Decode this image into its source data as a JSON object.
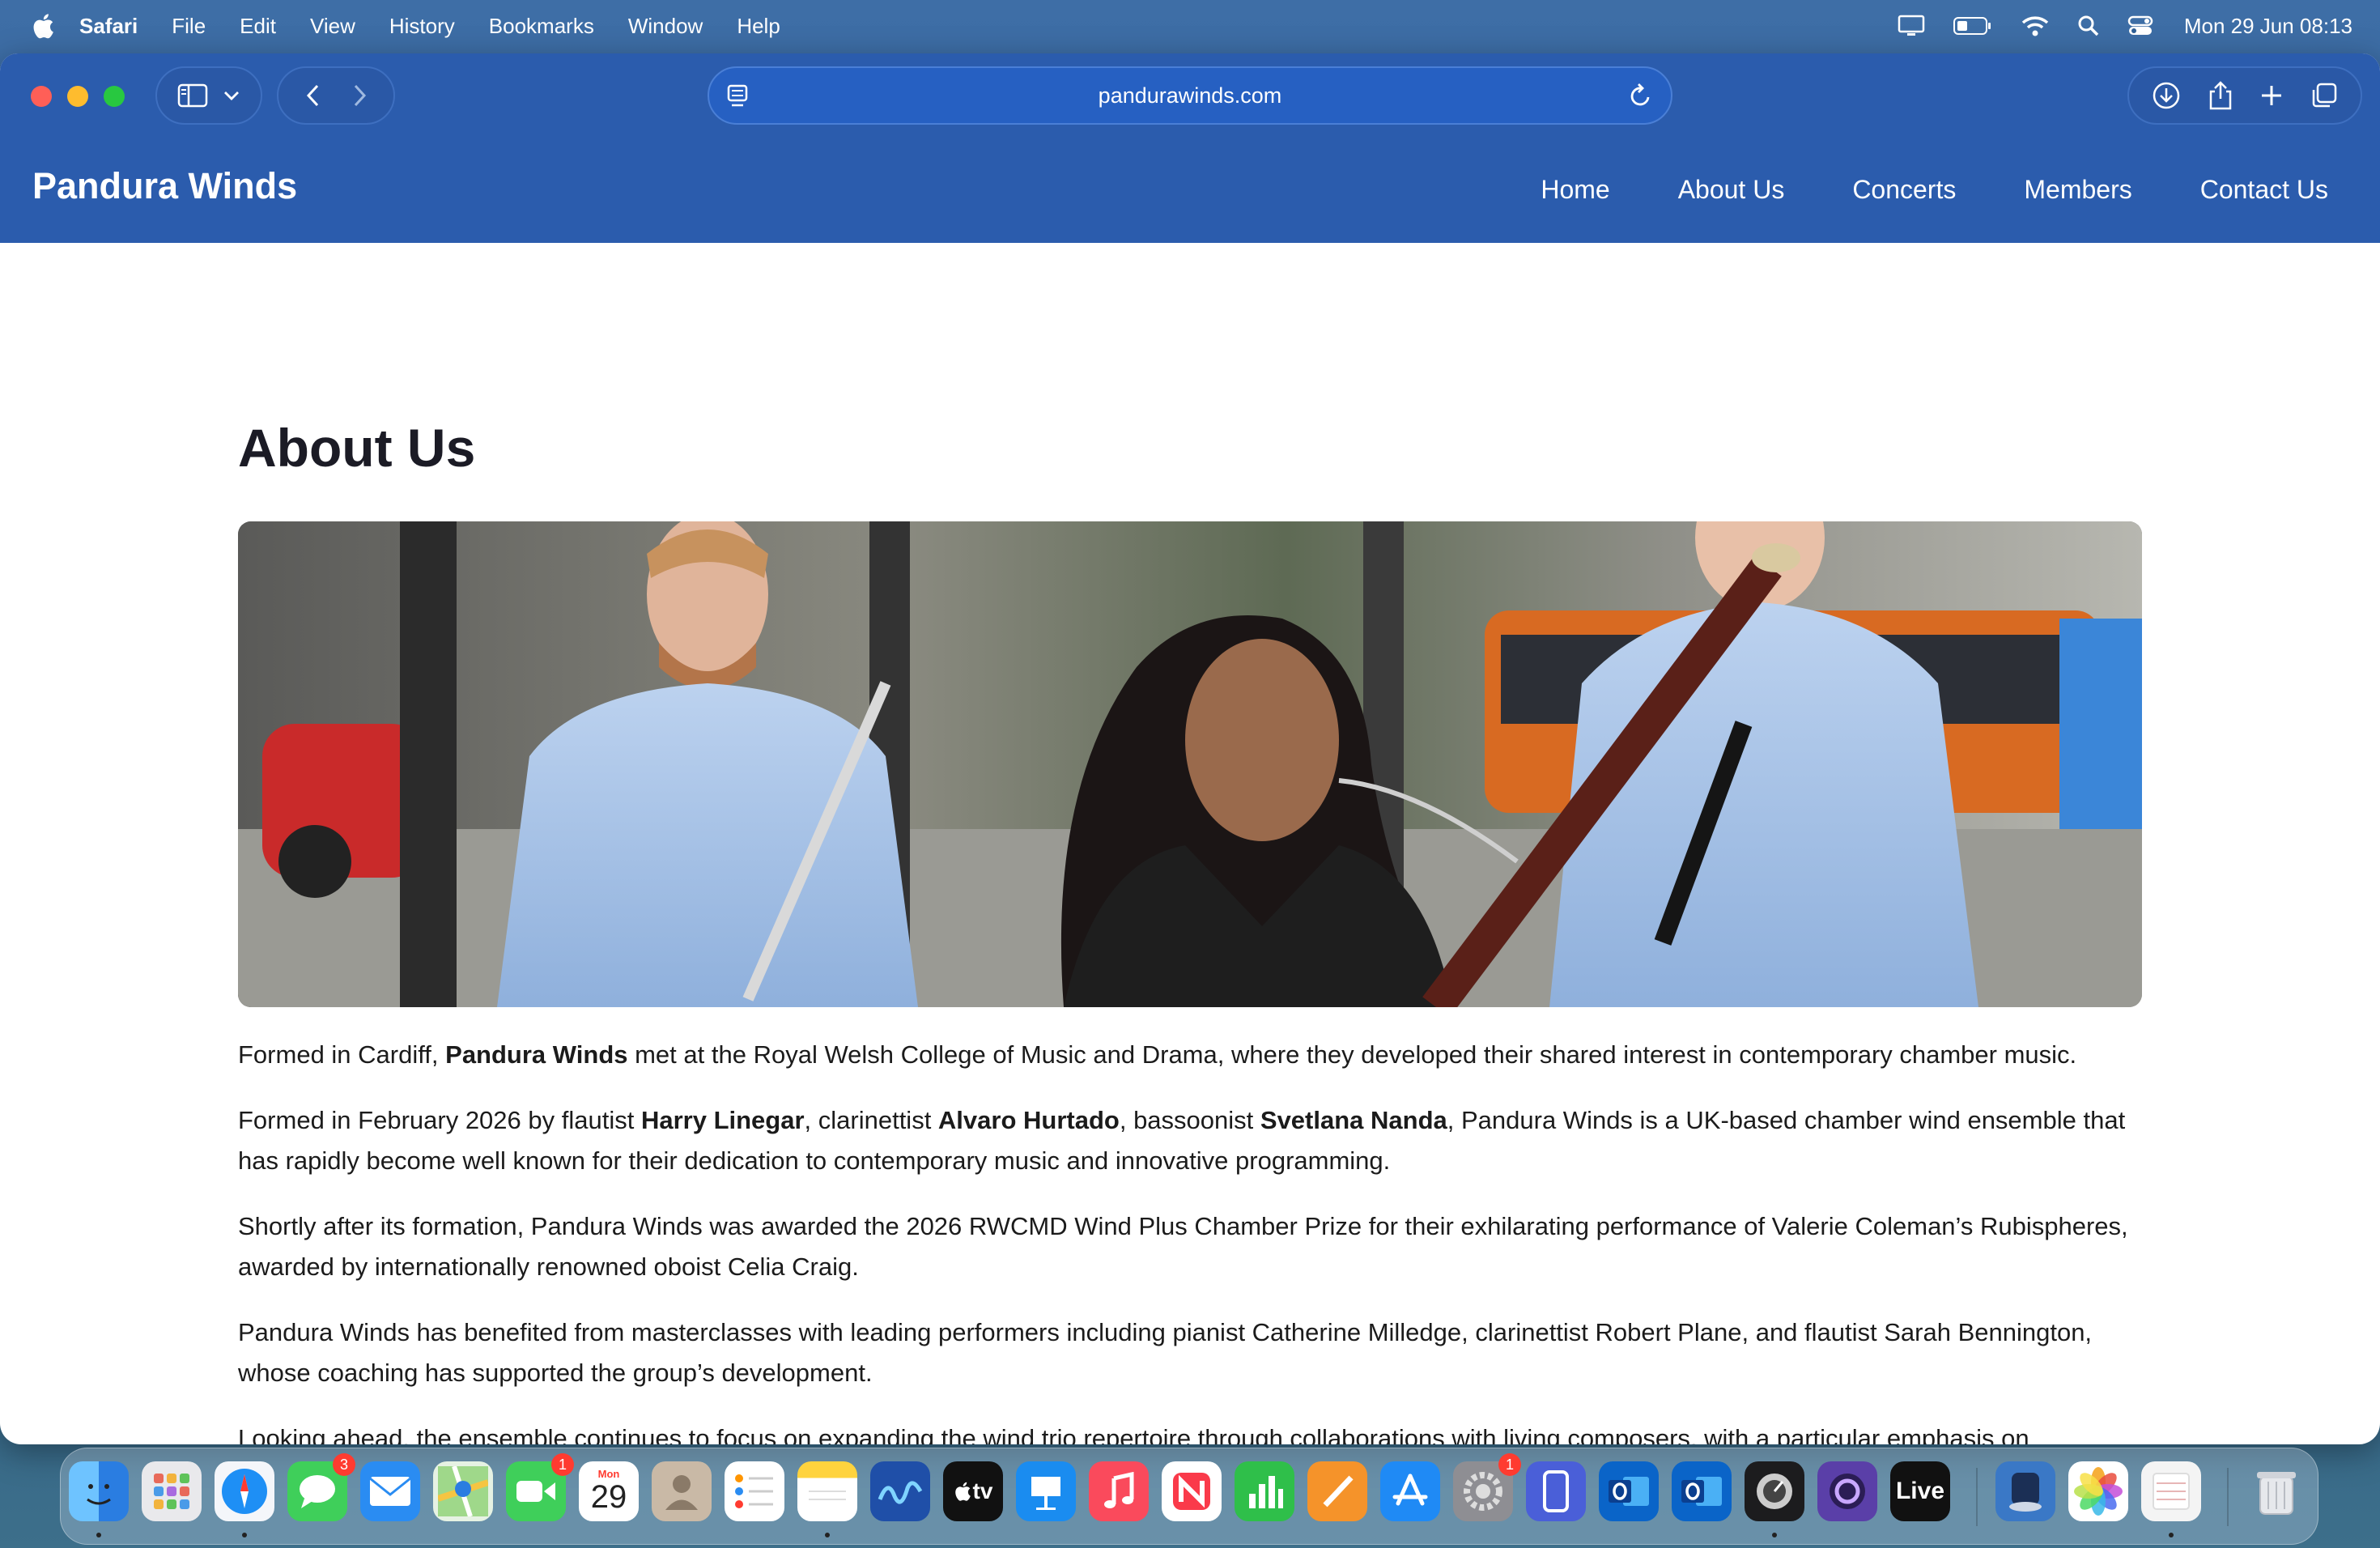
{
  "menubar": {
    "app_name": "Safari",
    "items": [
      "File",
      "Edit",
      "View",
      "History",
      "Bookmarks",
      "Window",
      "Help"
    ],
    "clock": "Mon 29 Jun  08:13",
    "status_icons": [
      "display-icon",
      "battery-icon",
      "wifi-icon",
      "spotlight-search-icon",
      "control-center-icon"
    ]
  },
  "browser": {
    "url": "pandurawinds.com",
    "toolbar_icons": [
      "sidebar-icon",
      "chevron-down-icon",
      "back-icon",
      "forward-icon",
      "page-menu-icon",
      "reload-icon",
      "downloads-icon",
      "share-icon",
      "new-tab-icon",
      "tab-overview-icon"
    ]
  },
  "site": {
    "title": "Pandura Winds",
    "nav": {
      "home": "Home",
      "about": "About Us",
      "concerts": "Concerts",
      "members": "Members",
      "contact": "Contact Us"
    }
  },
  "page": {
    "heading": "About Us",
    "paragraphs": [
      {
        "p1_a": "Formed in Cardiff, ",
        "p1_b": "Pandura Winds",
        "p1_c": " met at the Royal Welsh College of Music and Drama, where they developed their shared interest in contemporary chamber music."
      },
      {
        "p2_a": "Formed in February 2026 by flautist ",
        "p2_b": "Harry Linegar",
        "p2_c": ", clarinettist ",
        "p2_d": "Alvaro Hurtado",
        "p2_e": ", bassoonist ",
        "p2_f": "Svetlana Nanda",
        "p2_g": ", Pandura Winds is a UK-based chamber wind ensemble that has rapidly become well known for their dedication to contemporary music and innovative programming."
      },
      {
        "text": "Shortly after its formation, Pandura Winds was awarded the 2026 RWCMD Wind Plus Chamber Prize for their exhilarating performance of Valerie Coleman’s Rubispheres, awarded by internationally renowned oboist Celia Craig."
      },
      {
        "text": "Pandura Winds has benefited from masterclasses with leading performers including pianist Catherine Milledge, clarinettist Robert Plane, and flautist Sarah Bennington, whose coaching has supported the group’s development."
      },
      {
        "text": "Looking ahead, the ensemble continues to focus on expanding the wind trio repertoire through collaborations with living composers, with a particular emphasis on contemporary works and cross-disciplinary projects."
      }
    ]
  },
  "dock": {
    "calendar_month": "Mon",
    "calendar_day": "29",
    "tv_label": "tv",
    "live_label": "Live",
    "badges": {
      "messages": "3",
      "facetime": "1",
      "settings": "1"
    },
    "apps": [
      "Finder",
      "Launchpad",
      "Safari",
      "Messages",
      "Mail",
      "Maps",
      "FaceTime",
      "Calendar",
      "Contacts",
      "Reminders",
      "Notes",
      "Freeform",
      "TV",
      "Keynote",
      "Music",
      "News",
      "Numbers",
      "Pages",
      "App Store",
      "System Settings",
      "iPhone Mirroring",
      "Outlook",
      "Outlook",
      "Logic Pro",
      "Screenium",
      "Ableton Live",
      "Migration",
      "Photos",
      "Preview",
      "Trash"
    ]
  },
  "colors": {
    "accent": "#2b5cad",
    "heading": "#1b1b25",
    "body_text": "#1b1b1b"
  }
}
